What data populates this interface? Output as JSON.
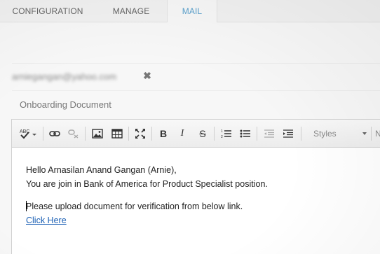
{
  "tabs": [
    {
      "label": "CONFIGURATION"
    },
    {
      "label": "MANAGE"
    },
    {
      "label": "MAIL"
    }
  ],
  "active_tab": "MAIL",
  "mail": {
    "recipient": "arniegangan@yahoo.com",
    "subject": "Onboarding Document"
  },
  "toolbar": {
    "icons": [
      "spellcheck-icon",
      "link-icon",
      "unlink-icon",
      "image-icon",
      "table-icon",
      "maximize-icon",
      "bold-icon",
      "italic-icon",
      "strikethrough-icon",
      "numbered-list-icon",
      "bulleted-list-icon",
      "outdent-icon",
      "indent-icon"
    ],
    "spell_label": "ABC",
    "bold": "B",
    "italic": "I",
    "strike": "S",
    "styles_label": "Styles",
    "next_label": "N"
  },
  "body": {
    "greeting": "Hello Arnasilan Anand Gangan (Arnie),",
    "line2": "You are join in Bank of America for Product Specialist position.",
    "line3": "Please upload document for verification from below link.",
    "link_text": "Click Here"
  },
  "colors": {
    "active_tab": "#5aa0cc",
    "link": "#1a5fb4"
  }
}
